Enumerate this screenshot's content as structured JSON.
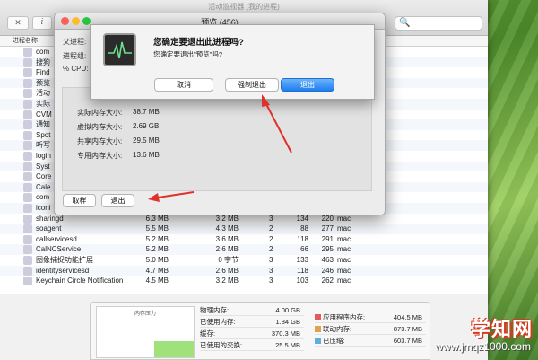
{
  "activity_monitor": {
    "window_title": "活动监视器 (我的进程)",
    "close_glyph": "✕",
    "info_glyph": "i",
    "column_header": "进程名称",
    "search_glyph": "🔍",
    "processes": [
      {
        "name": "com",
        "cpu_mem": "",
        "c2": "",
        "c3": "",
        "c4": "",
        "c5": "",
        "c6": ""
      },
      {
        "name": "搜狗",
        "cpu_mem": "",
        "c2": "",
        "c3": "",
        "c4": "",
        "c5": "",
        "c6": ""
      },
      {
        "name": "Find",
        "cpu_mem": "",
        "c2": "",
        "c3": "",
        "c4": "",
        "c5": "",
        "c6": ""
      },
      {
        "name": "预览",
        "cpu_mem": "",
        "c2": "",
        "c3": "",
        "c4": "",
        "c5": "",
        "c6": ""
      },
      {
        "name": "活动",
        "cpu_mem": "",
        "c2": "",
        "c3": "",
        "c4": "",
        "c5": "",
        "c6": ""
      },
      {
        "name": "实际",
        "cpu_mem": "",
        "c2": "",
        "c3": "",
        "c4": "",
        "c5": "",
        "c6": ""
      },
      {
        "name": "CVM",
        "cpu_mem": "",
        "c2": "",
        "c3": "",
        "c4": "",
        "c5": "",
        "c6": ""
      },
      {
        "name": "通知",
        "cpu_mem": "",
        "c2": "",
        "c3": "",
        "c4": "",
        "c5": "",
        "c6": ""
      },
      {
        "name": "Spot",
        "cpu_mem": "",
        "c2": "",
        "c3": "",
        "c4": "",
        "c5": "",
        "c6": ""
      },
      {
        "name": "听写",
        "cpu_mem": "",
        "c2": "",
        "c3": "",
        "c4": "",
        "c5": "",
        "c6": ""
      },
      {
        "name": "login",
        "cpu_mem": "",
        "c2": "",
        "c3": "",
        "c4": "",
        "c5": "",
        "c6": ""
      },
      {
        "name": "Syst",
        "cpu_mem": "",
        "c2": "",
        "c3": "",
        "c4": "",
        "c5": "",
        "c6": ""
      },
      {
        "name": "Core",
        "cpu_mem": "",
        "c2": "",
        "c3": "",
        "c4": "",
        "c5": "",
        "c6": ""
      },
      {
        "name": "Cale",
        "cpu_mem": "",
        "c2": "",
        "c3": "",
        "c4": "",
        "c5": "",
        "c6": ""
      },
      {
        "name": "com",
        "cpu_mem": "",
        "c2": "",
        "c3": "",
        "c4": "",
        "c5": "",
        "c6": ""
      },
      {
        "name": "iconi",
        "cpu_mem": "",
        "c2": "",
        "c3": "",
        "c4": "",
        "c5": "",
        "c6": ""
      },
      {
        "name": "sharingd",
        "cpu_mem": "6.3 MB",
        "c2": "3.2 MB",
        "c3": "3",
        "c4": "134",
        "c5": "220",
        "c6": "mac"
      },
      {
        "name": "soagent",
        "cpu_mem": "5.5 MB",
        "c2": "4.3 MB",
        "c3": "2",
        "c4": "88",
        "c5": "277",
        "c6": "mac"
      },
      {
        "name": "callservicesd",
        "cpu_mem": "5.2 MB",
        "c2": "3.6 MB",
        "c3": "2",
        "c4": "118",
        "c5": "291",
        "c6": "mac"
      },
      {
        "name": "CalNCService",
        "cpu_mem": "5.2 MB",
        "c2": "2.6 MB",
        "c3": "2",
        "c4": "66",
        "c5": "295",
        "c6": "mac"
      },
      {
        "name": "图象捕捉功能扩展",
        "cpu_mem": "5.0 MB",
        "c2": "0 字节",
        "c3": "3",
        "c4": "133",
        "c5": "463",
        "c6": "mac"
      },
      {
        "name": "identityservicesd",
        "cpu_mem": "4.7 MB",
        "c2": "2.6 MB",
        "c3": "3",
        "c4": "118",
        "c5": "246",
        "c6": "mac"
      },
      {
        "name": "Keychain Circle Notification",
        "cpu_mem": "4.5 MB",
        "c2": "3.2 MB",
        "c3": "3",
        "c4": "103",
        "c5": "262",
        "c6": "mac"
      }
    ],
    "memory_panel": {
      "graph_label": "内存压力",
      "stats": [
        {
          "label": "物理内存:",
          "value": "4.00 GB",
          "swatch": ""
        },
        {
          "label": "已使用内存:",
          "value": "1.84 GB",
          "swatch": ""
        },
        {
          "label": "缓存:",
          "value": "370.3 MB",
          "swatch": ""
        },
        {
          "label": "已使用的交换:",
          "value": "25.5 MB",
          "swatch": ""
        }
      ],
      "stats2": [
        {
          "label": "应用程序内存:",
          "value": "404.5 MB",
          "swatch": "#e25c5c"
        },
        {
          "label": "联动内存:",
          "value": "873.7 MB",
          "swatch": "#e2a14e"
        },
        {
          "label": "已压缩:",
          "value": "603.7 MB",
          "swatch": "#5faee0"
        }
      ],
      "pressure_fraction": 0.31
    }
  },
  "info_window": {
    "title": "预览 (456)",
    "fields": [
      "父进程:",
      "进程组:",
      "% CPU:"
    ],
    "memory": [
      {
        "label": "实际内存大小:",
        "value": "38.7 MB"
      },
      {
        "label": "虚拟内存大小:",
        "value": "2.69 GB"
      },
      {
        "label": "共享内存大小:",
        "value": "29.5 MB"
      },
      {
        "label": "专用内存大小:",
        "value": "13.6 MB"
      }
    ],
    "sample_button": "取样",
    "quit_button": "退出"
  },
  "quit_sheet": {
    "question": "您确定要退出此进程吗?",
    "subtext": "您确定要退出\"预览\"吗?",
    "cancel_label": "取消",
    "force_quit_label": "强制退出",
    "quit_label": "退出"
  },
  "watermark": {
    "brand": "学知网",
    "url": "www.jmqz1000.com"
  },
  "colors": {
    "arrow": "#e0302a",
    "primary_button": "#1f7ef0",
    "traffic_close": "#fc5f57",
    "traffic_min": "#fdbc2e",
    "traffic_max": "#28c840"
  }
}
